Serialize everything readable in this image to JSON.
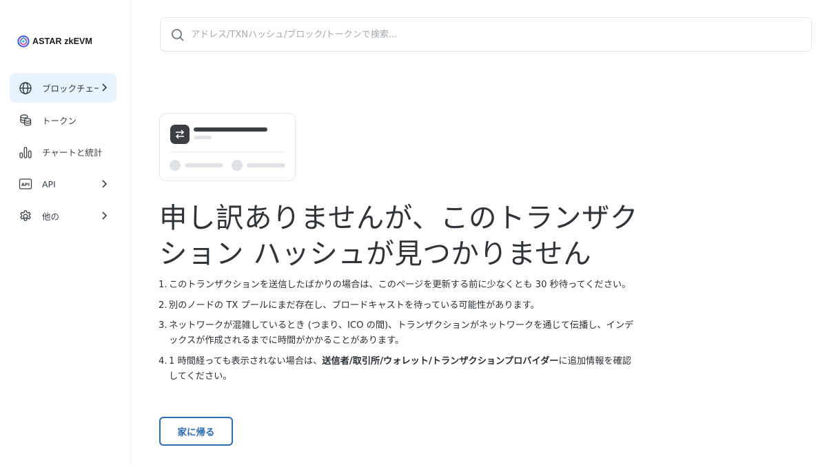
{
  "brand": {
    "name": "ASTAR zkEVM",
    "accent": "#2e6db4"
  },
  "sidebar": {
    "items": [
      {
        "label": "ブロックチェーン",
        "icon": "globe-icon",
        "has_chevron": true,
        "active": true
      },
      {
        "label": "トークン",
        "icon": "coins-icon",
        "has_chevron": false,
        "active": false
      },
      {
        "label": "チャートと統計",
        "icon": "bar-chart-icon",
        "has_chevron": false,
        "active": false
      },
      {
        "label": "API",
        "icon": "api-icon",
        "has_chevron": true,
        "active": false
      },
      {
        "label": "他の",
        "icon": "gear-icon",
        "has_chevron": true,
        "active": false
      }
    ]
  },
  "search": {
    "placeholder": "アドレス/TXNハッシュ/ブロック/トークンで検索...",
    "value": ""
  },
  "main": {
    "headline": "申し訳ありませんが、このトランザクション ハッシュが見つかりません",
    "reasons": [
      {
        "num": "1.",
        "text": "このトランザクションを送信したばかりの場合は、このページを更新する前に少なくとも 30 秒待ってください。"
      },
      {
        "num": "2.",
        "text": "別のノードの TX プールにまだ存在し、ブロードキャストを待っている可能性があります。"
      },
      {
        "num": "3.",
        "text": "ネットワークが混雑しているとき (つまり、ICO の間)、トランザクションがネットワークを通じて伝播し、インデックスが作成されるまでに時間がかかることがあります。"
      },
      {
        "num": "4.",
        "text_before": "1 時間経っても表示されない場合は、",
        "text_bold": "送信者/取引所/ウォレット/トランザクションプロバイダー",
        "text_after": "に追加情報を確認してください。"
      }
    ],
    "home_button": "家に帰る"
  }
}
